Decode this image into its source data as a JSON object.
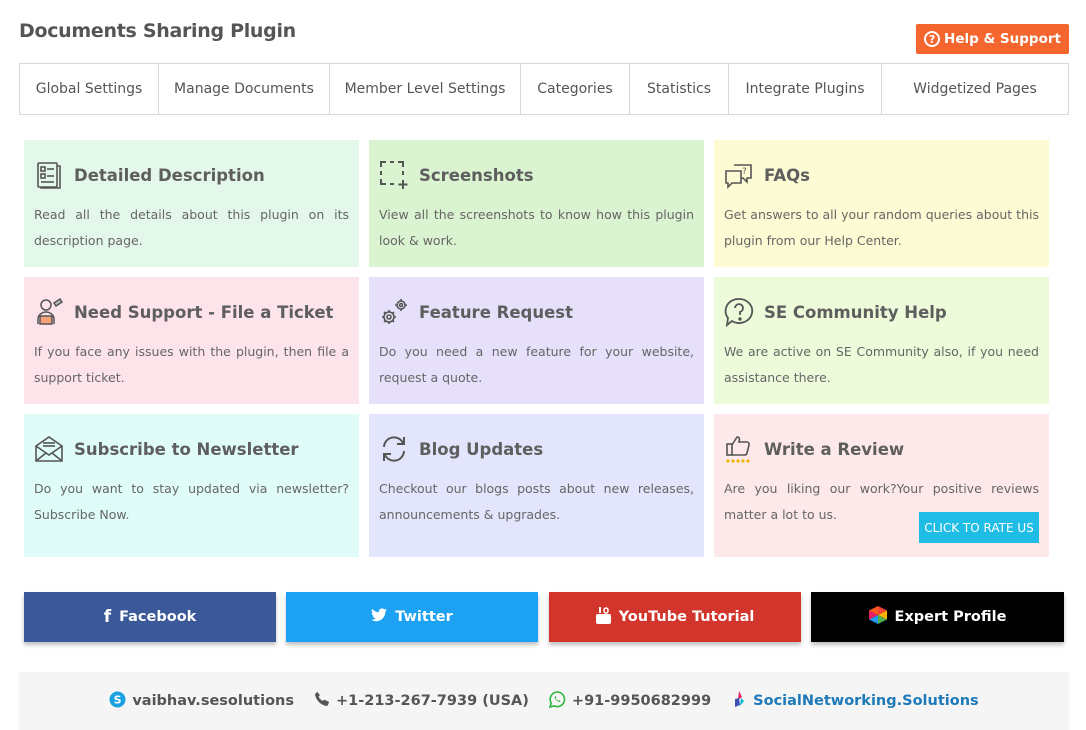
{
  "header": {
    "title": "Documents Sharing Plugin",
    "help_label": "Help & Support",
    "help_color": "#f5652e"
  },
  "tabs": [
    {
      "label": "Global Settings"
    },
    {
      "label": "Manage Documents"
    },
    {
      "label": "Member Level Settings"
    },
    {
      "label": "Categories"
    },
    {
      "label": "Statistics"
    },
    {
      "label": "Integrate Plugins"
    },
    {
      "label": "Widgetized Pages"
    }
  ],
  "cards": [
    {
      "title": "Detailed Description",
      "desc": "Read all the details about this plugin on its description page.",
      "icon": "document-list-icon",
      "bg": "#e3f7ea"
    },
    {
      "title": "Screenshots",
      "desc": "View all the screenshots to know how this plugin look & work.",
      "icon": "screenshot-crop-icon",
      "bg": "#daf3d0"
    },
    {
      "title": "FAQs",
      "desc": "Get answers to all your random queries about this plugin from our Help Center.",
      "icon": "chat-question-icon",
      "bg": "#fdfbd3"
    },
    {
      "title": "Need Support - File a Ticket",
      "desc": "If you face any issues with the plugin, then file a support ticket.",
      "icon": "support-agent-icon",
      "bg": "#fde3ea"
    },
    {
      "title": "Feature Request",
      "desc": "Do you need a new feature for your website, request a quote.",
      "icon": "gears-icon",
      "bg": "#e7e0fb"
    },
    {
      "title": "SE Community Help",
      "desc": "We are active on SE Community also, if you need assistance there.",
      "icon": "question-bubble-icon",
      "bg": "#eefbda"
    },
    {
      "title": "Subscribe to Newsletter",
      "desc": "Do you want to stay updated via newsletter? Subscribe Now.",
      "icon": "envelope-icon",
      "bg": "#dffcf8"
    },
    {
      "title": "Blog Updates",
      "desc": "Checkout our blogs posts about new releases, announcements & upgrades.",
      "icon": "refresh-icon",
      "bg": "#e2e5fb"
    },
    {
      "title": "Write a Review",
      "desc": "Are you liking our work?Your positive reviews matter a lot to us.",
      "icon": "thumbs-up-stars-icon",
      "bg": "#fde8ea"
    }
  ],
  "rate_button": {
    "label": "CLICK TO RATE US",
    "color": "#1fbde6"
  },
  "social": [
    {
      "label": "Facebook",
      "color": "#3b5998",
      "icon": "facebook-icon"
    },
    {
      "label": "Twitter",
      "color": "#1da1f2",
      "icon": "twitter-icon"
    },
    {
      "label": "YouTube Tutorial",
      "color": "#d1352b",
      "icon": "youtube-icon"
    },
    {
      "label": "Expert Profile",
      "color": "#000000",
      "icon": "expert-logo-icon"
    }
  ],
  "footer": {
    "skype": "vaibhav.sesolutions",
    "phone": "+1-213-267-7939 (USA)",
    "whatsapp": "+91-9950682999",
    "website": "SocialNetworking.Solutions"
  }
}
